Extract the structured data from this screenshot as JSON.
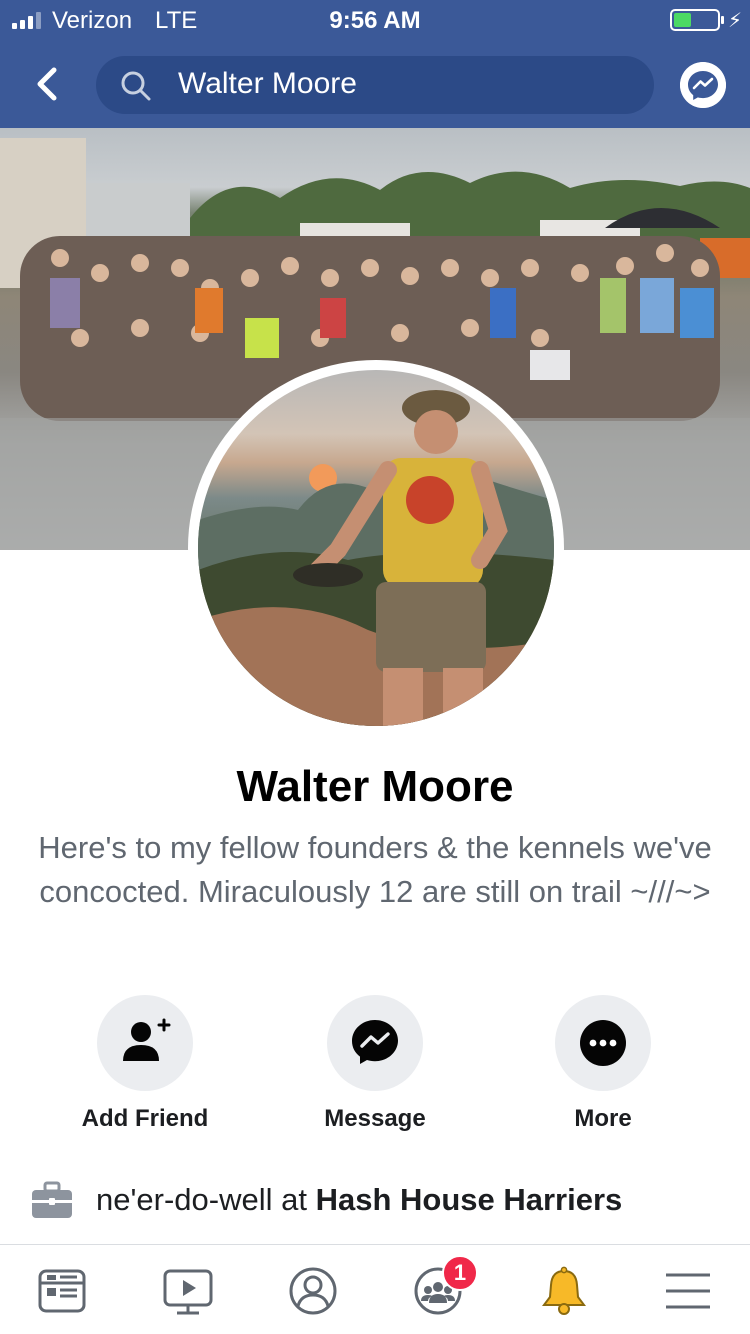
{
  "status_bar": {
    "carrier": "Verizon",
    "network": "LTE",
    "time": "9:56 AM",
    "battery_level": 0.4,
    "charging_icon": "bolt-icon"
  },
  "nav": {
    "back_icon": "chevron-left-icon",
    "search_value": "Walter Moore",
    "messenger_icon": "messenger-icon"
  },
  "profile": {
    "name": "Walter Moore",
    "bio": "Here's to my fellow founders & the kennels we've concocted. Miraculously 12 are still on trail ~///~>"
  },
  "actions": [
    {
      "label": "Add Friend",
      "icon": "add-friend-icon"
    },
    {
      "label": "Message",
      "icon": "messenger-icon"
    },
    {
      "label": "More",
      "icon": "more-icon"
    }
  ],
  "work": {
    "role": "ne'er-do-well at ",
    "employer": "Hash House Harriers",
    "icon": "briefcase-icon"
  },
  "tabs": [
    {
      "name": "news-feed",
      "icon": "news-feed-icon"
    },
    {
      "name": "watch",
      "icon": "watch-icon"
    },
    {
      "name": "profile",
      "icon": "profile-icon"
    },
    {
      "name": "groups",
      "icon": "groups-icon",
      "badge": "1"
    },
    {
      "name": "notifications",
      "icon": "bell-icon"
    },
    {
      "name": "menu",
      "icon": "menu-icon"
    }
  ],
  "colors": {
    "brand": "#3b5998",
    "search_bg": "#2c4a87",
    "badge": "#f02849",
    "bell": "#f7b928",
    "secondary_text": "#606770"
  }
}
